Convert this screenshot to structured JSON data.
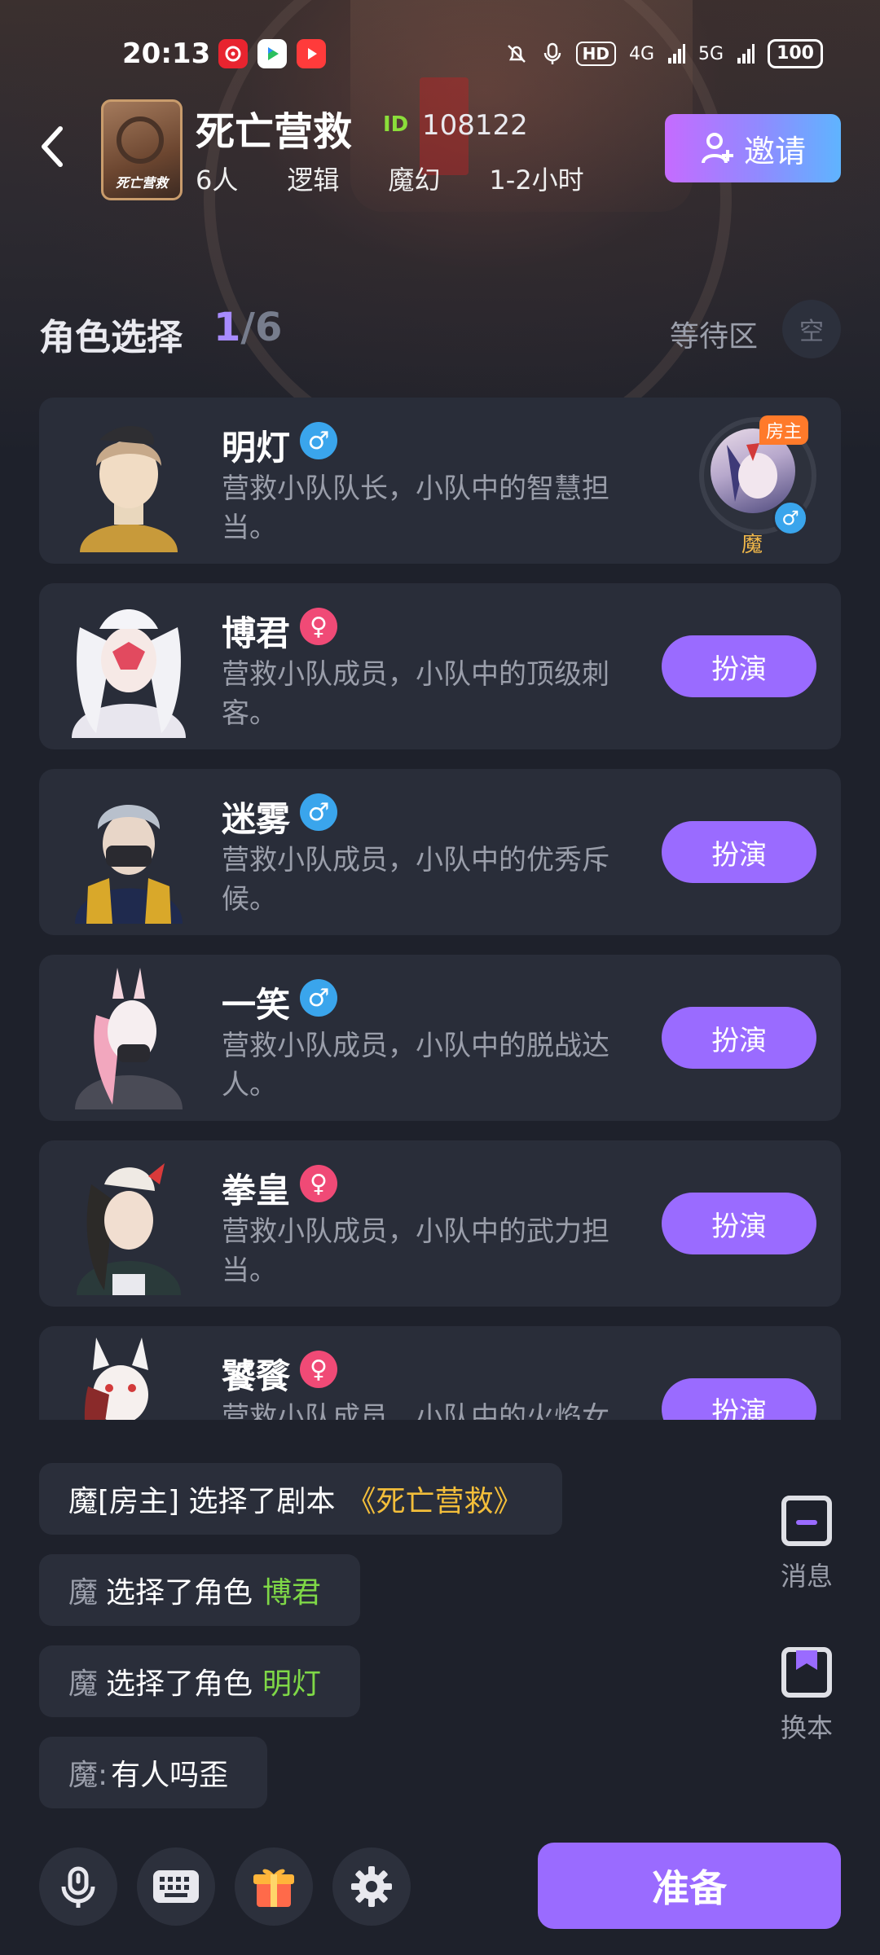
{
  "status_bar": {
    "time": "20:13",
    "network_labels": [
      "HD",
      "4G",
      "5G"
    ],
    "battery": "100"
  },
  "header": {
    "game_title": "死亡营救",
    "cover_text": "死亡营救",
    "id_label": "ID",
    "id_value": "108122",
    "tags": [
      "6人",
      "逻辑",
      "魔幻",
      "1-2小时"
    ],
    "invite_label": "邀请"
  },
  "role_section": {
    "title": "角色选择",
    "selected_count": "1",
    "total_count": "/6",
    "waiting_label": "等待区",
    "waiting_slot": "空"
  },
  "roles": [
    {
      "name": "明灯",
      "gender": "male",
      "gender_symbol": "♂",
      "desc": "营救小队队长，小队中的智慧担当。",
      "occupied_by": "魔",
      "host_badge": "房主"
    },
    {
      "name": "博君",
      "gender": "female",
      "gender_symbol": "♀",
      "desc": "营救小队成员，小队中的顶级刺客。",
      "action": "扮演"
    },
    {
      "name": "迷雾",
      "gender": "male",
      "gender_symbol": "♂",
      "desc": "营救小队成员，小队中的优秀斥候。",
      "action": "扮演"
    },
    {
      "name": "一笑",
      "gender": "male",
      "gender_symbol": "♂",
      "desc": "营救小队成员，小队中的脱战达人。",
      "action": "扮演"
    },
    {
      "name": "拳皇",
      "gender": "female",
      "gender_symbol": "♀",
      "desc": "营救小队成员，小队中的武力担当。",
      "action": "扮演"
    },
    {
      "name": "饕餮",
      "gender": "female",
      "gender_symbol": "♀",
      "desc": "营救小队成员，小队中的火焰女",
      "action": "扮演"
    }
  ],
  "messages": [
    {
      "who": "",
      "text": "魔[房主] 选择了剧本",
      "highlight": "《死亡营救》",
      "highlight_color": "yellow"
    },
    {
      "who": "魔",
      "text": "选择了角色",
      "highlight": "博君",
      "highlight_color": "green"
    },
    {
      "who": "魔",
      "text": "选择了角色",
      "highlight": "明灯",
      "highlight_color": "green"
    },
    {
      "who": "魔:",
      "text": "有人吗歪",
      "highlight": "",
      "highlight_color": ""
    }
  ],
  "side_actions": {
    "messages_label": "消息",
    "switch_script_label": "换本"
  },
  "bottom_bar": {
    "ready_label": "准备"
  },
  "colors": {
    "accent_purple": "#9a6bff",
    "male_blue": "#3aa5ec",
    "female_pink": "#f04a76",
    "host_orange": "#ff7a2a",
    "highlight_green": "#7fd847",
    "highlight_yellow": "#f3be3a"
  }
}
